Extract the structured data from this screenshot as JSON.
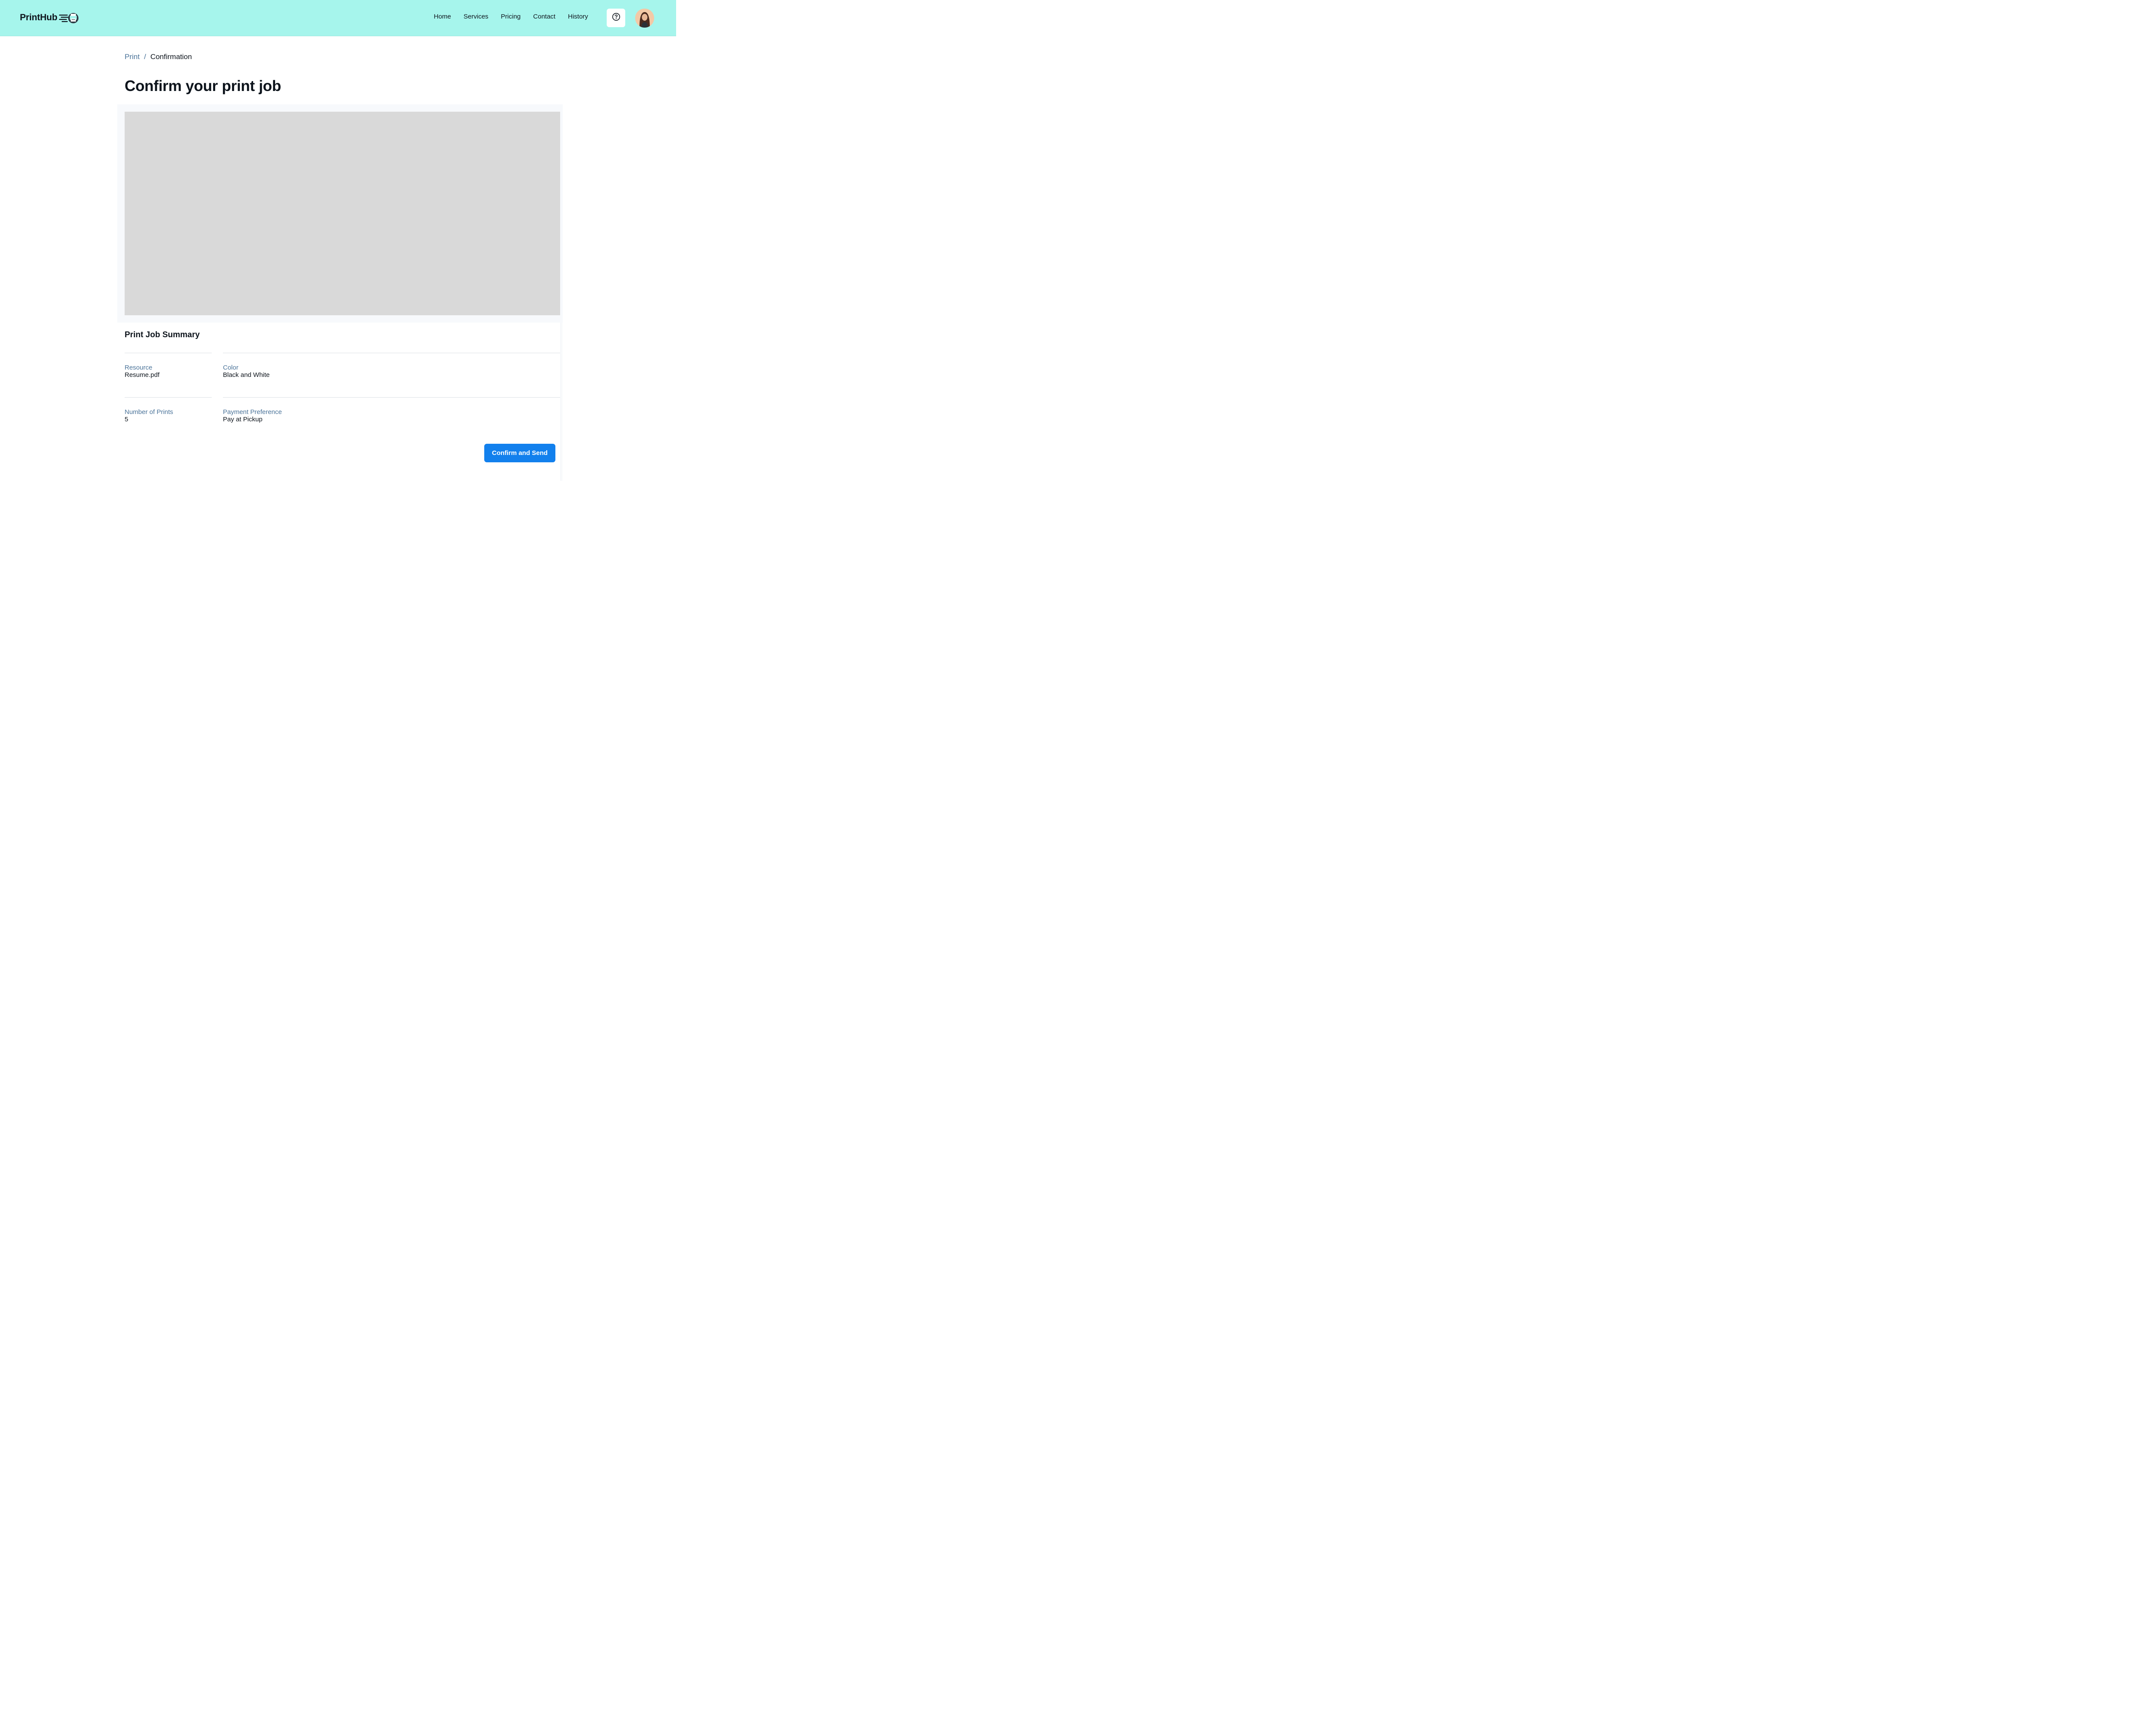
{
  "header": {
    "brand": "PrintHub",
    "brand_icon": "printer-speed-icon",
    "nav": [
      {
        "label": "Home"
      },
      {
        "label": "Services"
      },
      {
        "label": "Pricing"
      },
      {
        "label": "Contact"
      },
      {
        "label": "History"
      }
    ],
    "help_icon": "question-circle-icon",
    "avatar": "user-avatar",
    "background": "#a6f5ec"
  },
  "breadcrumb": {
    "link": "Print",
    "separator": "/",
    "current": "Confirmation"
  },
  "page_title": "Confirm your print job",
  "summary": {
    "title": "Print Job Summary",
    "fields": [
      {
        "label": "Resource",
        "value": "Resume.pdf"
      },
      {
        "label": "Color",
        "value": "Black and White"
      },
      {
        "label": "Number of Prints",
        "value": "5"
      },
      {
        "label": "Payment Preference",
        "value": "Pay at Pickup"
      }
    ]
  },
  "actions": {
    "confirm_label": "Confirm and Send",
    "confirm_color": "#1280ed"
  },
  "colors": {
    "label_blue": "#4a7399",
    "preview_gray": "#d9d9d9"
  }
}
